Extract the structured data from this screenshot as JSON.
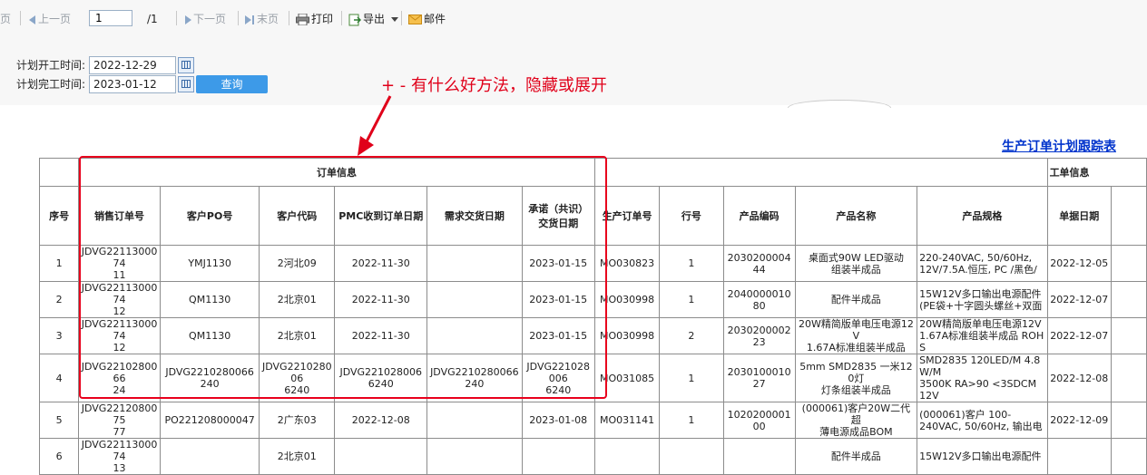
{
  "toolbar": {
    "first_page_fragment": "页",
    "prev_label": "上一页",
    "page_value": "1",
    "page_total": "/1",
    "next_label": "下一页",
    "last_label": "末页",
    "print_label": "打印",
    "export_label": "导出",
    "mail_label": "邮件"
  },
  "filter": {
    "start_label": "计划开工时间:",
    "start_value": "2022-12-29",
    "end_label": "计划完工时间:",
    "end_value": "2023-01-12",
    "query_label": "查询"
  },
  "annotation": "+ - 有什么好方法，隐藏或展开",
  "report": {
    "title": "生产订单计划跟踪表",
    "groups": {
      "order_info": "订单信息",
      "work_info": "工单信息"
    },
    "columns": [
      "序号",
      "销售订单号",
      "客户PO号",
      "客户代码",
      "PMC收到订单日期",
      "需求交货日期",
      "承诺（共识）\n交货日期",
      "生产订单号",
      "行号",
      "产品编码",
      "产品名称",
      "产品规格",
      "单据日期"
    ],
    "rows": [
      [
        "1",
        "JDVG2211300074\n11",
        "YMJ1130",
        "2河北09",
        "2022-11-30",
        "",
        "2023-01-15",
        "MO030823",
        "1",
        "203020000444",
        "桌面式90W LED驱动\n组装半成品",
        "220-240VAC, 50/60Hz,\n12V/7.5A.恒压, PC /黑色/",
        "2022-12-05"
      ],
      [
        "2",
        "JDVG2211300074\n12",
        "QM1130",
        "2北京01",
        "2022-11-30",
        "",
        "2023-01-15",
        "MO030998",
        "1",
        "204000001080",
        "配件半成品",
        "15W12V多口输出电源配件\n(PE袋+十字圆头螺丝+双面",
        "2022-12-07"
      ],
      [
        "3",
        "JDVG2211300074\n12",
        "QM1130",
        "2北京01",
        "2022-11-30",
        "",
        "2023-01-15",
        "MO030998",
        "2",
        "203020000223",
        "20W精简版单电压电源12V\n1.67A标准组装半成品",
        "20W精简版单电压电源12V\n1.67A标准组装半成品 ROHS",
        "2022-12-07"
      ],
      [
        "4",
        "JDVG2210280066\n24",
        "JDVG2210280066240",
        "JDVG221028006\n6240",
        "JDVG2210280066240",
        "JDVG2210280066240",
        "JDVG221028006\n6240",
        "MO031085",
        "1",
        "203010001027",
        "5mm SMD2835 一米120灯\n灯条组装半成品",
        "SMD2835 120LED/M 4.8W/M\n3500K RA>90 <3SDCM 12V",
        "2022-12-08"
      ],
      [
        "5",
        "JDVG2212080075\n77",
        "PO221208000047",
        "2广东03",
        "2022-12-08",
        "",
        "2023-01-08",
        "MO031141",
        "1",
        "102020000100",
        "(000061)客户20W二代超\n薄电源成品BOM",
        "(000061)客户 100-\n240VAC, 50/60Hz, 输出电",
        "2022-12-09"
      ],
      [
        "6",
        "JDVG2211300074\n13",
        "",
        "2北京01",
        "",
        "",
        "",
        "",
        "",
        "",
        "配件半成品",
        "15W12V多口输出电源配件",
        ""
      ]
    ]
  }
}
